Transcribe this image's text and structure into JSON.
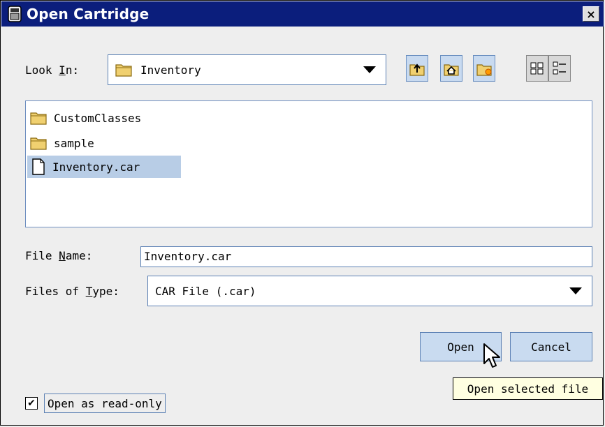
{
  "window": {
    "title": "Open Cartridge",
    "close_label": "×",
    "app_icon": "cartridge-icon"
  },
  "lookin": {
    "label_pre": "Look ",
    "label_mnemonic": "I",
    "label_post": "n:",
    "value": "Inventory",
    "value_icon": "folder-icon"
  },
  "toolbar": {
    "buttons": [
      {
        "name": "up-one-level",
        "icon": "folder-up-icon"
      },
      {
        "name": "home",
        "icon": "home-icon"
      },
      {
        "name": "new-folder",
        "icon": "new-folder-icon"
      },
      {
        "name": "list-view",
        "icon": "list-view-icon"
      },
      {
        "name": "details-view",
        "icon": "details-view-icon"
      }
    ]
  },
  "files": [
    {
      "name": "CustomClasses",
      "type": "folder",
      "selected": false
    },
    {
      "name": "sample",
      "type": "folder",
      "selected": false
    },
    {
      "name": "Inventory.car",
      "type": "file",
      "selected": true
    }
  ],
  "filename": {
    "label_pre": "File ",
    "label_mnemonic": "N",
    "label_post": "ame:",
    "value": "Inventory.car"
  },
  "filetype": {
    "label_pre": "Files of ",
    "label_mnemonic": "T",
    "label_post": "ype:",
    "value": "CAR File (.car)"
  },
  "buttons": {
    "open": "Open",
    "cancel": "Cancel"
  },
  "tooltip": "Open selected file",
  "readonly": {
    "label": "Open as read-only",
    "checked": true,
    "check_glyph": "✔"
  },
  "colors": {
    "titlebar": "#0b1e7c",
    "selection": "#b8cde6",
    "button": "#c9dbf0",
    "folder": "#f0d070"
  }
}
